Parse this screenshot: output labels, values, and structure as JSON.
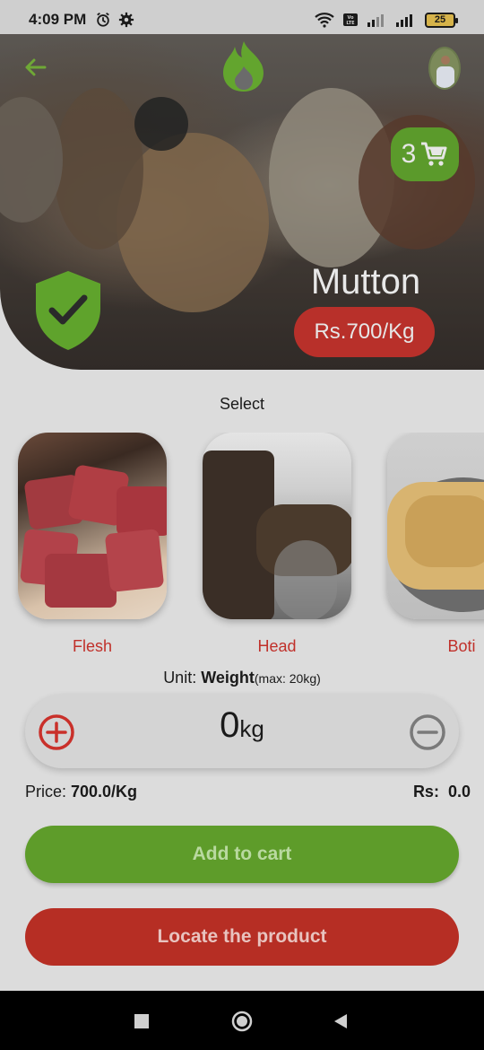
{
  "status_bar": {
    "time": "4:09 PM",
    "battery": "25",
    "icons": [
      "alarm-icon",
      "gear-icon",
      "wifi-icon",
      "volte-icon",
      "signal-icon",
      "battery-icon"
    ]
  },
  "header": {
    "icons": [
      "back-arrow-icon",
      "flame-logo-icon",
      "avatar"
    ]
  },
  "cart": {
    "count": "3",
    "icon": "cart-icon"
  },
  "product": {
    "name": "Mutton",
    "price": "Rs.700/Kg"
  },
  "select_label": "Select",
  "parts": [
    {
      "name": "Flesh"
    },
    {
      "name": "Head"
    },
    {
      "name": "Boti"
    }
  ],
  "unit": {
    "prefix": "Unit: ",
    "type": "Weight",
    "max": "(max: 20kg)"
  },
  "quantity": {
    "value": "0",
    "unit": "kg"
  },
  "price_row": {
    "price_label": "Price: ",
    "price_value": "700.0/Kg",
    "total_label": "Rs:",
    "total_value": "0.0"
  },
  "buttons": {
    "add_to_cart": "Add to cart",
    "locate": "Locate the product"
  },
  "colors": {
    "green": "#5e9c2a",
    "red": "#b62e24",
    "text_red": "#c0302a"
  }
}
